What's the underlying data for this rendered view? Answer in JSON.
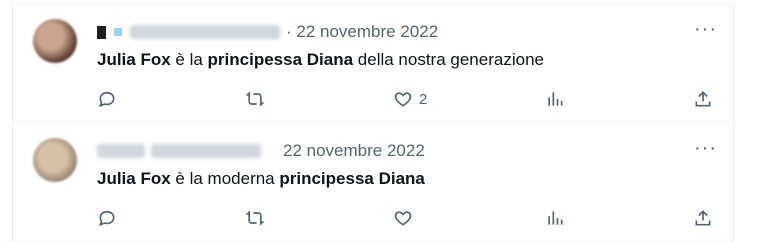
{
  "tweets": [
    {
      "date": "22 novembre 2022",
      "text_parts": {
        "p1": "Julia Fox",
        "p2": " è la ",
        "p3": "principessa Diana",
        "p4": " della nostra generazione"
      },
      "more_label": "···",
      "actions": {
        "like_count": "2"
      }
    },
    {
      "date": "22 novembre 2022",
      "text_parts": {
        "p1": "Julia Fox",
        "p2": " è la moderna ",
        "p3": "principessa Diana",
        "p4": ""
      },
      "more_label": "···",
      "actions": {
        "like_count": ""
      }
    }
  ],
  "icons": {
    "reply": "reply-icon",
    "retweet": "retweet-icon",
    "like": "heart-icon",
    "views": "views-icon",
    "share": "share-icon",
    "more": "more-icon"
  },
  "colors": {
    "text": "#0f1419",
    "muted": "#536471",
    "divider": "#eff3f4"
  }
}
